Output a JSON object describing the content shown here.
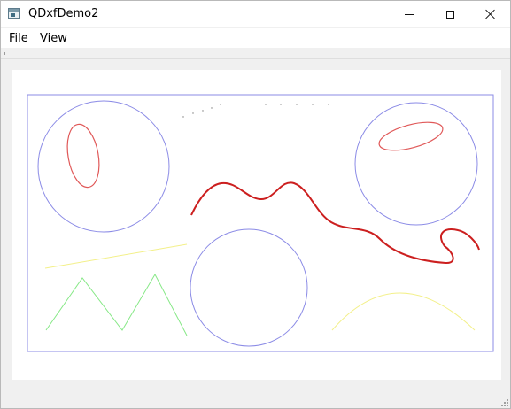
{
  "window": {
    "title": "QDxfDemo2",
    "controls": [
      "minimize",
      "maximize",
      "close"
    ]
  },
  "menu": {
    "file": "File",
    "view": "View"
  },
  "drawing": {
    "entities": [
      "border-rectangle",
      "circle",
      "ellipse",
      "dotted-line",
      "polyline",
      "spline",
      "line",
      "zigzag-polyline",
      "arc"
    ],
    "colors": {
      "blue": "#8b8be6",
      "red": "#e05858",
      "dark_red": "#cc1f1f",
      "yellow": "#f3f08a",
      "green": "#86e886"
    }
  },
  "icons": {
    "app": "application-window-icon",
    "minimize": "minimize-icon",
    "maximize": "maximize-icon",
    "close": "close-icon"
  }
}
